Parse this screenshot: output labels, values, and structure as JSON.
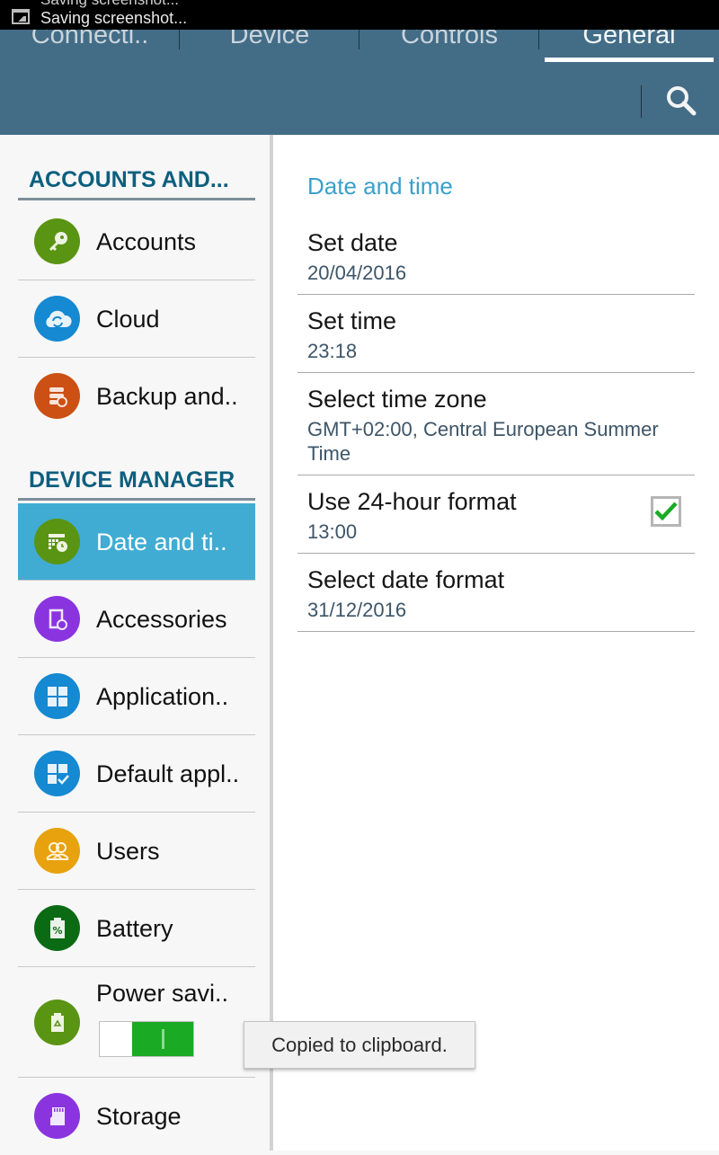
{
  "status_bar": {
    "notification_prev": "Saving screenshot...",
    "notification": "Saving screenshot..."
  },
  "tabs": [
    {
      "label": "Connecti..",
      "active": false
    },
    {
      "label": "Device",
      "active": false
    },
    {
      "label": "Controls",
      "active": false
    },
    {
      "label": "General",
      "active": true
    }
  ],
  "search_icon": "search-icon",
  "sidebar": {
    "sections": [
      {
        "title": "ACCOUNTS AND...",
        "items": [
          {
            "label": "Accounts",
            "icon": "key-icon",
            "color": "#5a9413"
          },
          {
            "label": "Cloud",
            "icon": "cloud-sync-icon",
            "color": "#1589d2"
          },
          {
            "label": "Backup and..",
            "icon": "backup-icon",
            "color": "#cc4f14"
          }
        ]
      },
      {
        "title": "DEVICE MANAGER",
        "items": [
          {
            "label": "Date and ti..",
            "icon": "calendar-clock-icon",
            "color": "#5a9413",
            "selected": true
          },
          {
            "label": "Accessories",
            "icon": "accessories-icon",
            "color": "#8a34e0"
          },
          {
            "label": "Application..",
            "icon": "apps-grid-icon",
            "color": "#1589d2"
          },
          {
            "label": "Default appl..",
            "icon": "default-apps-icon",
            "color": "#1589d2"
          },
          {
            "label": "Users",
            "icon": "users-icon",
            "color": "#e8a20e"
          },
          {
            "label": "Battery",
            "icon": "battery-icon",
            "color": "#0b6b14"
          },
          {
            "label": "Power savi..",
            "icon": "power-saving-icon",
            "color": "#5a9413",
            "toggle_on": true
          },
          {
            "label": "Storage",
            "icon": "sd-card-icon",
            "color": "#8a34e0"
          }
        ]
      }
    ]
  },
  "detail": {
    "title": "Date and time",
    "prefs": [
      {
        "title": "Set date",
        "summary": "20/04/2016"
      },
      {
        "title": "Set time",
        "summary": "23:18"
      },
      {
        "title": "Select time zone",
        "summary": "GMT+02:00, Central European Summer Time"
      },
      {
        "title": "Use 24-hour format",
        "summary": "13:00",
        "checked": true
      },
      {
        "title": "Select date format",
        "summary": "31/12/2016"
      }
    ]
  },
  "toast": "Copied to clipboard.",
  "colors": {
    "action_bar": "#436c86",
    "accent": "#3aa0c9",
    "selected_item": "#40acd3",
    "section_title": "#0c5f7e",
    "check": "#1aaa24"
  }
}
